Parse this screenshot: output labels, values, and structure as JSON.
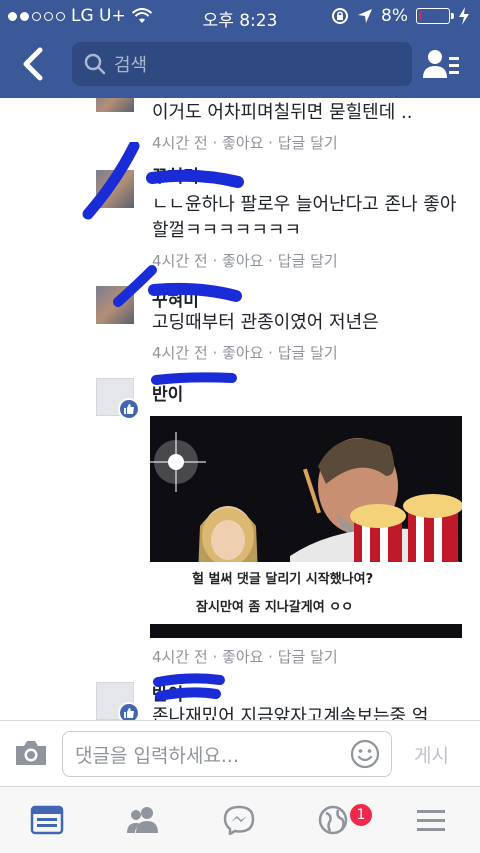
{
  "status_bar": {
    "carrier": "LG U+",
    "time": "오후 8:23",
    "battery": "8%",
    "battery_level": 0.08
  },
  "navbar": {
    "search_placeholder": "검색"
  },
  "comments": [
    {
      "text": "이거도 어차피며칠뒤면 묻힐텐데 ..",
      "meta": "4시간 전 · 좋아요 · 답글 달기"
    },
    {
      "name": "꾸혀미",
      "text": "ㄴㄴ윤하나 팔로우 늘어난다고 존나 좋아할껄ㅋㅋㅋㅋㅋㅋㅋ",
      "meta": "4시간 전 · 좋아요 · 답글 달기"
    },
    {
      "name": "꾸혀미",
      "text": "고딩때부터 관종이였어 저년은",
      "meta": "4시간 전 · 좋아요 · 답글 달기"
    },
    {
      "name": "반이",
      "meta": "4시간 전 · 좋아요 · 답글 달기",
      "image_caption_line1": "헐 벌써 댓글 달리기 시작했나여?",
      "image_caption_line2": "잠시만여 좀 지나갈게여 ㅇㅇ"
    },
    {
      "name": "반이",
      "text": "존나재밌어 지금앞자고계속보는중 엌"
    }
  ],
  "composer": {
    "placeholder": "댓글을 입력하세요...",
    "post_label": "게시"
  },
  "tabbar": {
    "notification_count": "1"
  },
  "colors": {
    "brand": "#3b5998",
    "scribble": "#1a2bd8",
    "badge": "#f02849"
  }
}
